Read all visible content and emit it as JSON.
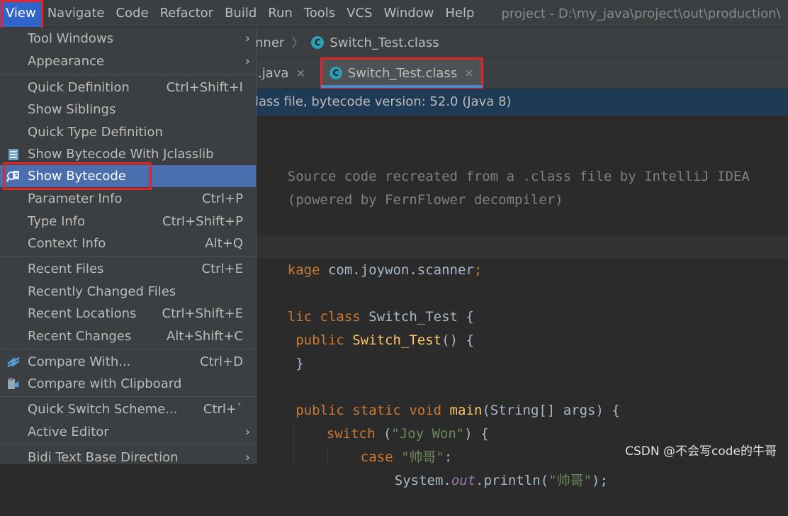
{
  "menubar": {
    "items": [
      "View",
      "Navigate",
      "Code",
      "Refactor",
      "Build",
      "Run",
      "Tools",
      "VCS",
      "Window",
      "Help"
    ],
    "title": "project - D:\\my_java\\project\\out\\production\\"
  },
  "breadcrumb": {
    "prev": "nner",
    "file": "Switch_Test.class"
  },
  "tabs": {
    "prev": ".java",
    "active": "Switch_Test.class"
  },
  "banner": "lass file, bytecode version: 52.0 (Java 8)",
  "code": {
    "cmt1": "Source code recreated from a .class file by IntelliJ IDEA",
    "cmt2": "(powered by FernFlower decompiler)",
    "pkg_kw": "kage",
    "pkg_name": " com.joywon.scanner",
    "pkg_semi": ";",
    "cls_kw": "lic class",
    "cls_name": " Switch_Test {",
    "ctor_kw": " public ",
    "ctor_name": "Switch_Test",
    "ctor_rest": "() {",
    "close1": " }",
    "main_kw": " public static void ",
    "main_name": "main",
    "main_rest": "(String[] args) {",
    "sw_kw": "switch",
    "sw_open": " (",
    "sw_str": "\"Joy Won\"",
    "sw_close": ") {",
    "case_kw": "case ",
    "case_str": "\"帅哥\"",
    "case_colon": ":",
    "sys_a": "System.",
    "sys_out": "out",
    "sys_b": ".println(",
    "sys_str": "\"帅哥\"",
    "sys_c": ");"
  },
  "dropdown": {
    "items": [
      {
        "label": "Tool Windows",
        "shortcut": "",
        "submenu": true
      },
      {
        "label": "Appearance",
        "shortcut": "",
        "submenu": true
      },
      {
        "label": "Quick Definition",
        "shortcut": "Ctrl+Shift+I",
        "submenu": false
      },
      {
        "label": "Show Siblings",
        "shortcut": "",
        "submenu": false
      },
      {
        "label": "Quick Type Definition",
        "shortcut": "",
        "submenu": false
      },
      {
        "label": "Show Bytecode With Jclasslib",
        "shortcut": "",
        "submenu": false
      },
      {
        "label": "Show Bytecode",
        "shortcut": "",
        "submenu": false
      },
      {
        "label": "Parameter Info",
        "shortcut": "Ctrl+P",
        "submenu": false
      },
      {
        "label": "Type Info",
        "shortcut": "Ctrl+Shift+P",
        "submenu": false
      },
      {
        "label": "Context Info",
        "shortcut": "Alt+Q",
        "submenu": false
      },
      {
        "label": "Recent Files",
        "shortcut": "Ctrl+E",
        "submenu": false
      },
      {
        "label": "Recently Changed Files",
        "shortcut": "",
        "submenu": false
      },
      {
        "label": "Recent Locations",
        "shortcut": "Ctrl+Shift+E",
        "submenu": false
      },
      {
        "label": "Recent Changes",
        "shortcut": "Alt+Shift+C",
        "submenu": false
      },
      {
        "label": "Compare With...",
        "shortcut": "Ctrl+D",
        "submenu": false
      },
      {
        "label": "Compare with Clipboard",
        "shortcut": "",
        "submenu": false
      },
      {
        "label": "Quick Switch Scheme...",
        "shortcut": "Ctrl+`",
        "submenu": false
      },
      {
        "label": "Active Editor",
        "shortcut": "",
        "submenu": true
      },
      {
        "label": "Bidi Text Base Direction",
        "shortcut": "",
        "submenu": true
      }
    ],
    "arrow": "›"
  },
  "watermark": "CSDN @不会写code的牛哥",
  "colors": {
    "accent": "#2f65ca",
    "highlight": "#4b6eaf",
    "annotation": "#e0252b"
  }
}
